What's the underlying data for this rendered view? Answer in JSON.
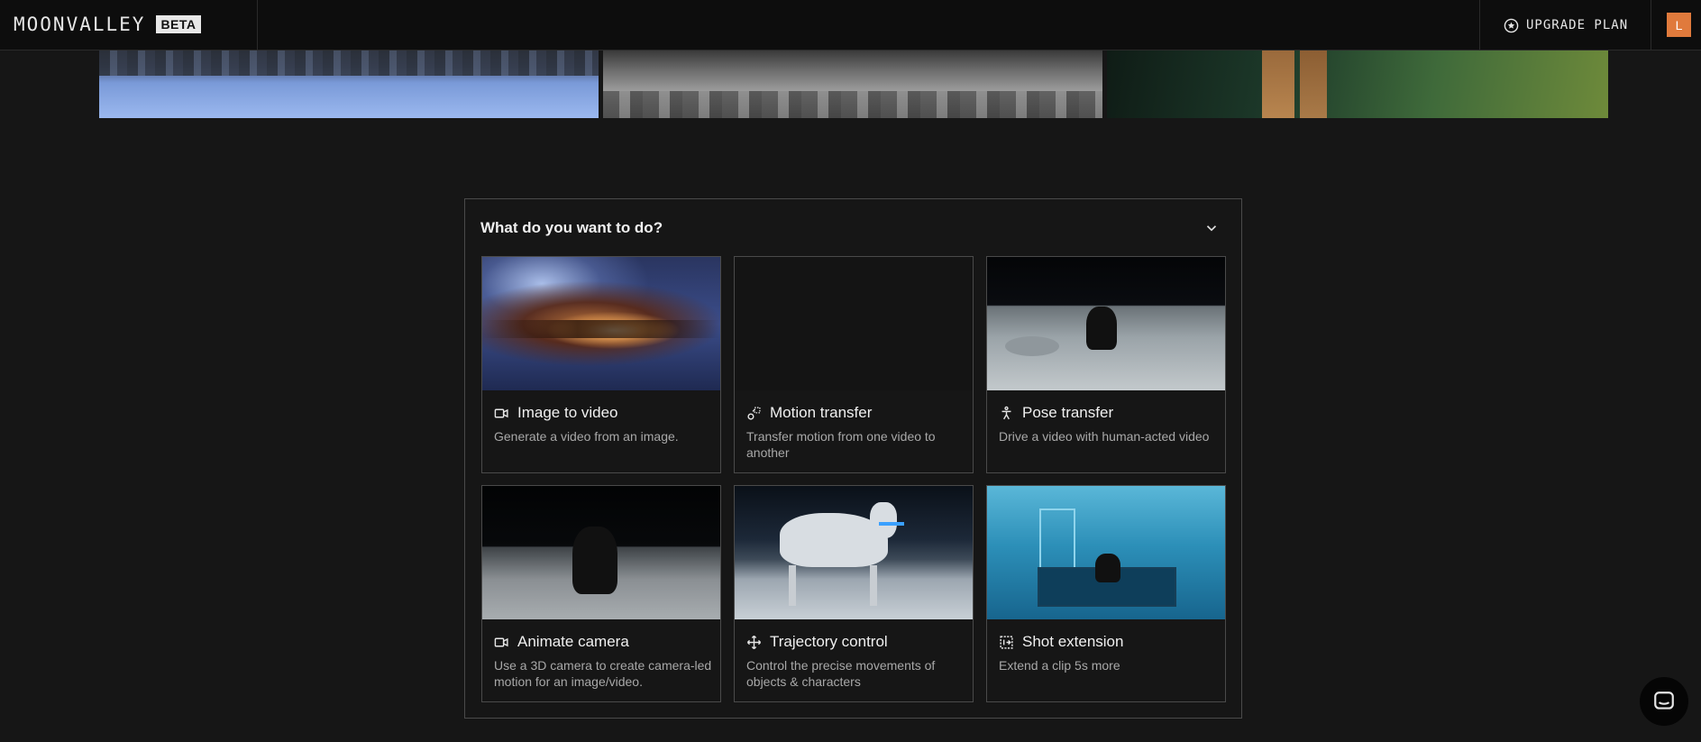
{
  "header": {
    "logo_text": "MOONVALLEY",
    "beta_label": "BETA",
    "upgrade_label": "UPGRADE PLAN",
    "avatar_initial": "L"
  },
  "panel": {
    "title": "What do you want to do?",
    "cards": [
      {
        "title": "Image to video",
        "desc": "Generate a video from an image.",
        "icon": "video-camera-icon"
      },
      {
        "title": "Motion transfer",
        "desc": "Transfer motion from one video to another",
        "icon": "motion-transfer-icon"
      },
      {
        "title": "Pose transfer",
        "desc": "Drive a video with human-acted video",
        "icon": "person-pose-icon"
      },
      {
        "title": "Animate camera",
        "desc": "Use a 3D camera to create camera-led motion for an image/video.",
        "icon": "video-camera-icon"
      },
      {
        "title": "Trajectory control",
        "desc": "Control the precise movements of objects & characters",
        "icon": "move-arrows-icon"
      },
      {
        "title": "Shot extension",
        "desc": "Extend a clip 5s more",
        "icon": "shot-extension-icon"
      }
    ]
  },
  "colors": {
    "background": "#161616",
    "topbar": "#0d0d0d",
    "avatar": "#e07a3c",
    "border": "#4a4a4a"
  }
}
